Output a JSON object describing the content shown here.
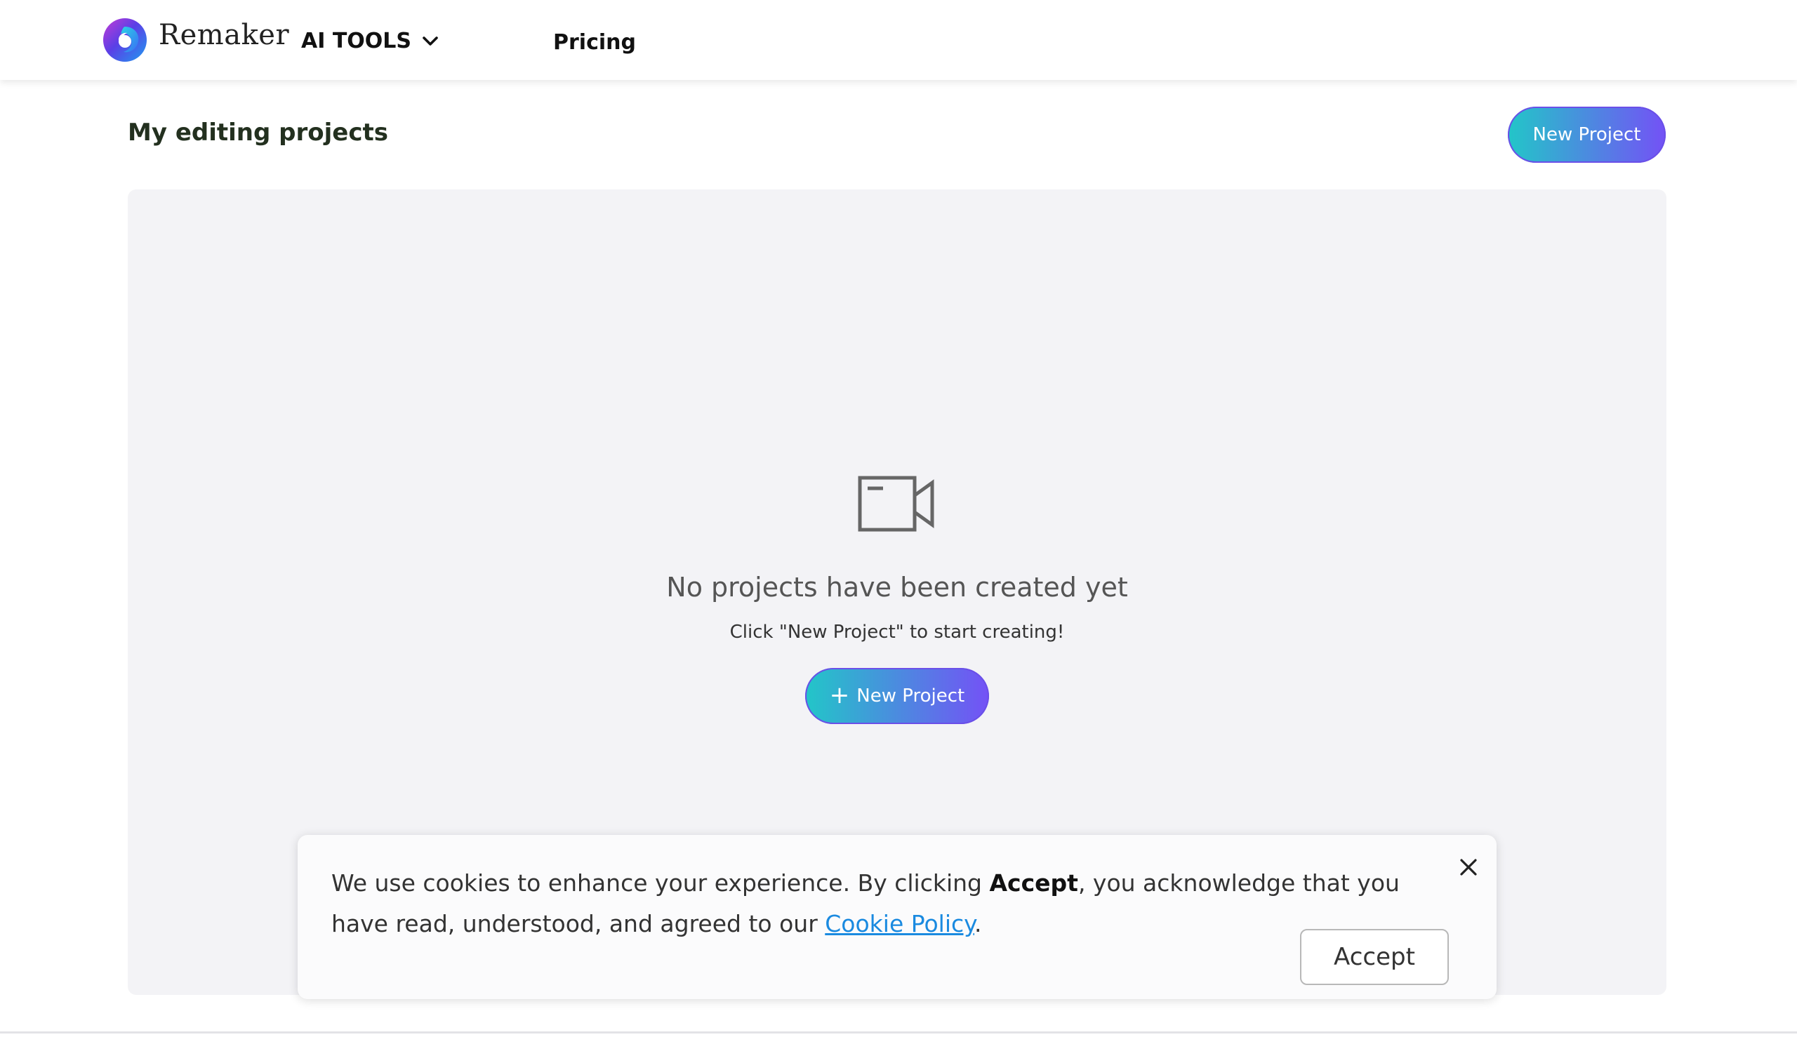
{
  "header": {
    "brand": "Remaker",
    "nav_tools_label": "AI TOOLS",
    "nav_pricing_label": "Pricing"
  },
  "page": {
    "title": "My editing projects",
    "new_project_label": "New Project"
  },
  "empty_state": {
    "title": "No projects have been created yet",
    "subtitle": "Click \"New Project\" to start creating!",
    "button_label": "New Project",
    "icon": "video-camera-icon"
  },
  "cookie_banner": {
    "text_before": "We use cookies to enhance your experience. By clicking ",
    "text_bold": "Accept",
    "text_after": ", you acknowledge that you have read, understood, and agreed to our ",
    "link_label": "Cookie Policy",
    "text_end": ".",
    "accept_label": "Accept"
  },
  "colors": {
    "gradient_start": "#22c6c8",
    "gradient_end": "#7451f6",
    "panel_bg": "#f3f3f6",
    "link": "#1a8ae0"
  }
}
